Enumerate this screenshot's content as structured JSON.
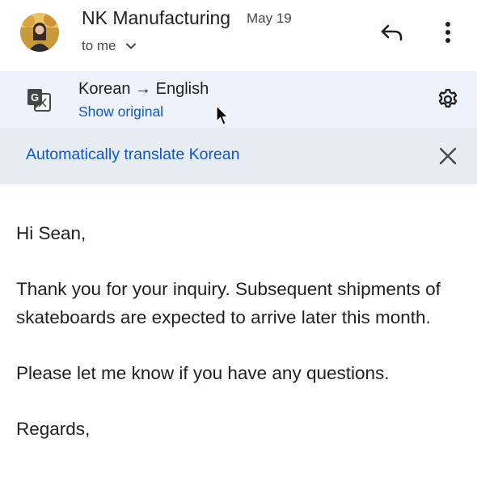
{
  "header": {
    "sender": "NK Manufacturing",
    "date": "May 19",
    "recipient": "to me",
    "icons": [
      "avatar",
      "chevron-down-icon",
      "reply-icon",
      "more-vert-icon"
    ]
  },
  "translation": {
    "language_line": "Korean → English",
    "show_original": "Show original",
    "icons": [
      "translate-icon",
      "gear-icon",
      "cursor-icon"
    ]
  },
  "auto_translate": {
    "label": "Automatically translate Korean",
    "icons": [
      "close-icon"
    ]
  },
  "message": {
    "greeting": "Hi Sean,",
    "paragraph1": "Thank you for your inquiry. Subsequent shipments of skateboards are expected to arrive later this month.",
    "paragraph2": "Please let me know if you have any questions.",
    "closing": "Regards,"
  },
  "colors": {
    "link": "#0b57d0",
    "translate_bar": "#eef3fb",
    "auto_bar": "#e8edf4",
    "text": "#1f1f1f",
    "secondary_text": "#444746"
  }
}
